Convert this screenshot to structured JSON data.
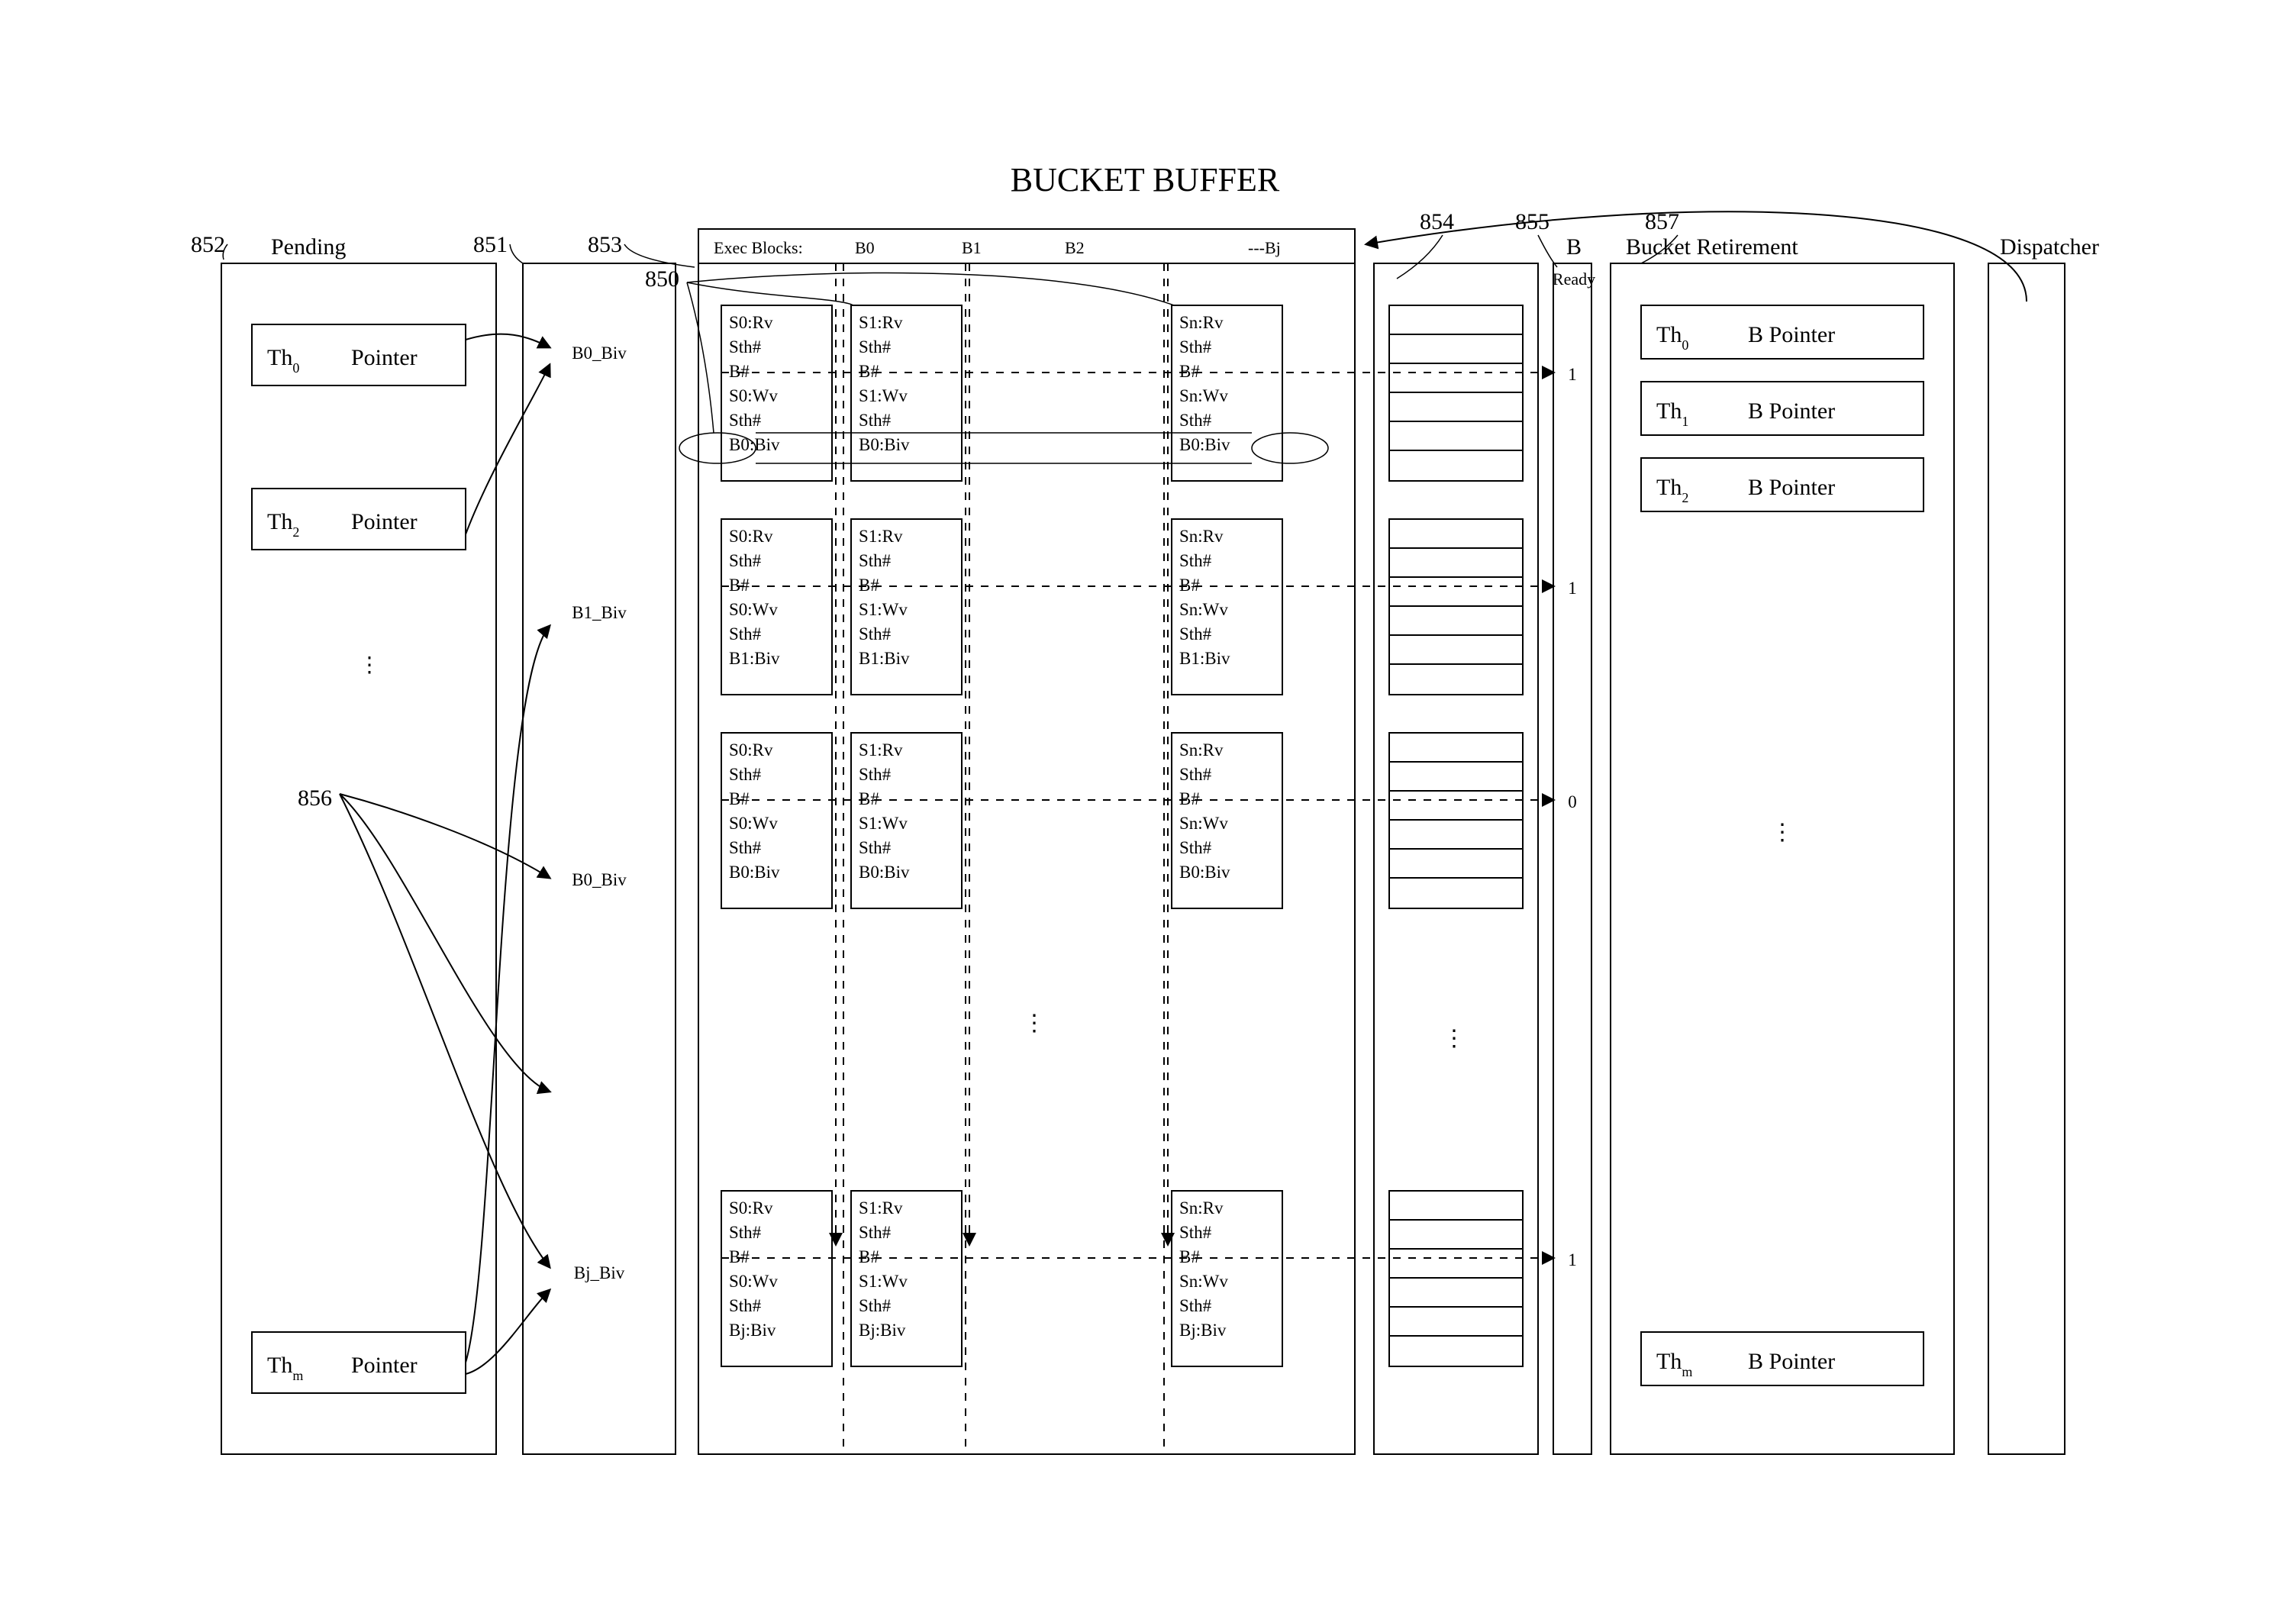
{
  "title": "BUCKET BUFFER",
  "refs": {
    "r850": "850",
    "r851": "851",
    "r852": "852",
    "r853": "853",
    "r854": "854",
    "r855": "855",
    "r856": "856",
    "r857": "857"
  },
  "labels": {
    "pending": "Pending",
    "ready": "Ready",
    "bucketRetirement": "Bucket Retirement",
    "dispatcher": "Dispatcher",
    "execBlocks": "Exec Blocks:",
    "B0": "B0",
    "B1": "B1",
    "B2": "B2",
    "Bj": "---Bj",
    "B": "B"
  },
  "pending": {
    "th0": "Th",
    "th0sub": "0",
    "th2": "Th",
    "th2sub": "2",
    "thm": "Th",
    "thmsub": "m",
    "ptr": "Pointer"
  },
  "biv_col": {
    "b0": "B0_Biv",
    "b1": "B1_Biv",
    "b0b": "B0_Biv",
    "bj": "Bj_Biv"
  },
  "source_block": {
    "r0": [
      "S0:Rv",
      "Sth#",
      "B#",
      "S0:Wv",
      "Sth#"
    ],
    "r1": [
      "S1:Rv",
      "Sth#",
      "B#",
      "S1:Wv",
      "Sth#"
    ],
    "rn": [
      "Sn:Rv",
      "Sth#",
      "B#",
      "Sn:Wv",
      "Sth#"
    ]
  },
  "biv_row": {
    "row1": "B0:Biv",
    "row2": "B1:Biv",
    "row3": "B0:Biv",
    "row4": "Bj:Biv"
  },
  "ready_bits": {
    "r1": "1",
    "r2": "1",
    "r3": "0",
    "r4": "1"
  },
  "retire": {
    "th0": "Th",
    "th0sub": "0",
    "th1": "Th",
    "th1sub": "1",
    "th2": "Th",
    "th2sub": "2",
    "thm": "Th",
    "thmsub": "m",
    "bptr": "B Pointer"
  },
  "chart_data": {
    "type": "table",
    "title": "Bucket Buffer architecture diagram",
    "components": [
      {
        "id": 852,
        "name": "Pending thread pointer table",
        "entries": [
          "Th0 Pointer",
          "Th2 Pointer",
          "...",
          "Thm Pointer"
        ]
      },
      {
        "id": 851,
        "name": "Bucket inherit-vector column",
        "entries": [
          "B0_Biv",
          "B1_Biv",
          "B0_Biv",
          "...",
          "Bj_Biv"
        ]
      },
      {
        "id": 853,
        "name": "Execution blocks header",
        "columns": [
          "B0",
          "B1",
          "B2",
          "---Bj"
        ]
      },
      {
        "id": 850,
        "name": "Bucket source/Biv oval callout",
        "row_fields": [
          "S*:Rv",
          "Sth#",
          "B#",
          "S*:Wv",
          "Sth#",
          "B*:Biv"
        ]
      },
      {
        "id": 854,
        "name": "Merge network into ready bits"
      },
      {
        "id": 855,
        "name": "Ready bit column",
        "values": [
          1,
          1,
          0,
          1
        ]
      },
      {
        "id": 857,
        "name": "Bucket Retirement thread table",
        "entries": [
          "Th0 B Pointer",
          "Th1 B Pointer",
          "Th2 B Pointer",
          "...",
          "Thm B Pointer"
        ]
      },
      {
        "id": 856,
        "name": "Fan-out arrows from pending pointers to Biv column"
      },
      {
        "name": "Dispatcher",
        "role": "feeds Exec Blocks header"
      }
    ]
  }
}
